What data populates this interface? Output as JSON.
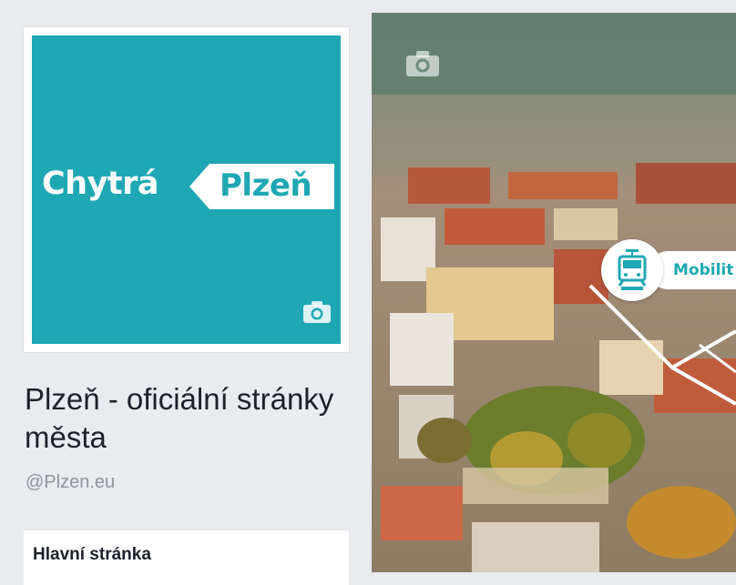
{
  "profile": {
    "logo_left": "Chytrá",
    "logo_right": "Plzeň",
    "brand_color": "#1fa8b4",
    "camera_icon": "camera-icon"
  },
  "page": {
    "title": "Plzeň - oficiální stránky města",
    "handle": "@Plzen.eu"
  },
  "nav": {
    "items": [
      {
        "label": "Hlavní stránka"
      }
    ]
  },
  "cover": {
    "camera_icon": "camera-icon",
    "badge_icon": "tram-icon",
    "badge_label": "Mobilit"
  }
}
